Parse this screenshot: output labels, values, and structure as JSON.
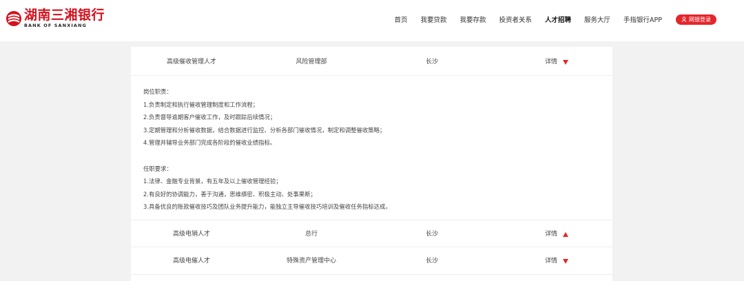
{
  "brand": {
    "name_cn": "湖南三湘银行",
    "name_en": "BANK OF SANXIANG",
    "logo_icon": "sanxiang-logo-icon",
    "color": "#d4111d"
  },
  "nav": {
    "items": [
      {
        "label": "首页"
      },
      {
        "label": "我要贷款"
      },
      {
        "label": "我要存款"
      },
      {
        "label": "投资者关系"
      },
      {
        "label": "人才招聘"
      },
      {
        "label": "服务大厅"
      },
      {
        "label": "手指银行APP"
      }
    ],
    "active": "人才招聘",
    "login_label": "网银登录",
    "login_icon": "user-icon",
    "login_color": "#e4262c"
  },
  "jobs": [
    {
      "title": "高级催收管理人才",
      "department": "风险管理部",
      "location": "长沙",
      "detail_label": "详情",
      "expanded": true,
      "arrow_icon": "caret-down-icon"
    },
    {
      "title": "高级电销人才",
      "department": "总行",
      "location": "长沙",
      "detail_label": "详情",
      "expanded": false,
      "arrow_icon": "caret-up-icon"
    },
    {
      "title": "高级电催人才",
      "department": "特殊资产管理中心",
      "location": "长沙",
      "detail_label": "详情",
      "expanded": false,
      "arrow_icon": "caret-down-icon"
    }
  ],
  "job_description": {
    "duties_heading": "岗位职责：",
    "duties": [
      "1.负责制定和执行催收管理制度和工作流程；",
      "2.负责督导逾期客户催收工作，及时跟踪后续情况；",
      "3.定期管理和分析催收数据，结合数据进行监控、分析各部门催收情况，制定和调整催收策略；",
      "4.管理并辅导业务部门完成各阶段的催收业绩指标。"
    ],
    "requirements_heading": "任职要求：",
    "requirements": [
      "1.法律、金融专业背景，有五年及以上催收管理经验；",
      "2.有良好的协调能力，善于沟通，思维缜密、积极主动、处事果断；",
      "3.具备优良的账款催收技巧及团队业务提升能力，能独立主导催收技巧培训及催收任务指标达成。"
    ]
  }
}
